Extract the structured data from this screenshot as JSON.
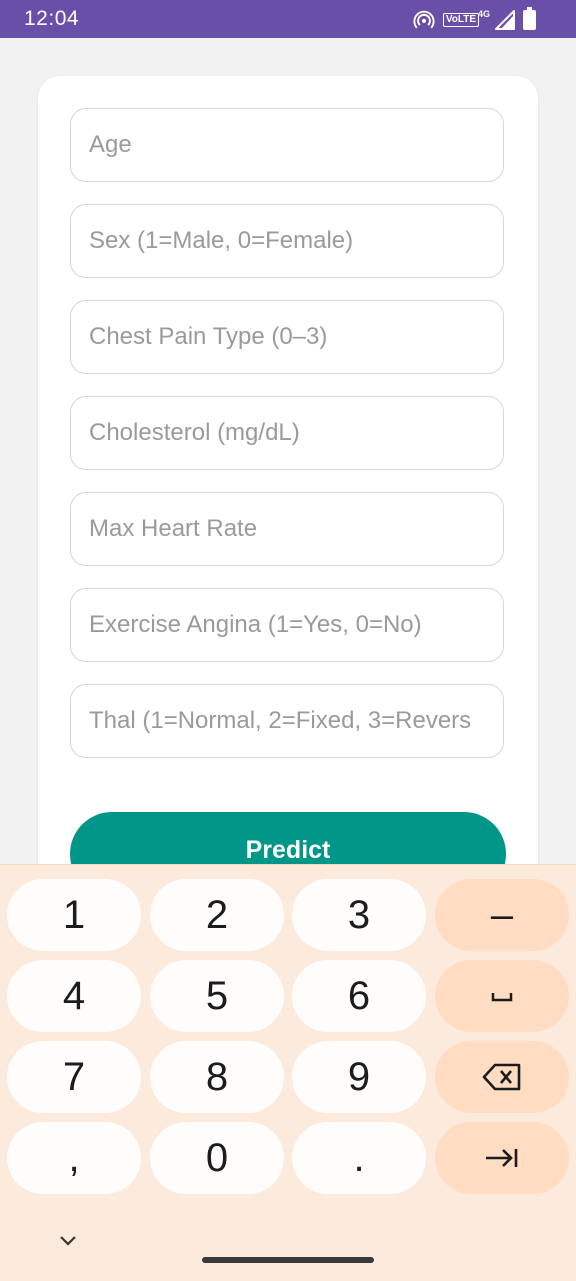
{
  "status_bar": {
    "time": "12:04",
    "volte": "VoLTE",
    "network": "4G",
    "icons": [
      "hotspot-icon",
      "signal-icon",
      "battery-icon"
    ]
  },
  "form": {
    "fields": [
      {
        "name": "age-field",
        "placeholder": "Age",
        "value": ""
      },
      {
        "name": "sex-field",
        "placeholder": "Sex (1=Male, 0=Female)",
        "value": ""
      },
      {
        "name": "chest-pain-type-field",
        "placeholder": "Chest Pain Type (0–3)",
        "value": ""
      },
      {
        "name": "cholesterol-field",
        "placeholder": "Cholesterol (mg/dL)",
        "value": ""
      },
      {
        "name": "max-heart-rate-field",
        "placeholder": "Max Heart Rate",
        "value": ""
      },
      {
        "name": "exercise-angina-field",
        "placeholder": "Exercise Angina (1=Yes, 0=No)",
        "value": ""
      },
      {
        "name": "thal-field",
        "placeholder": "Thal (1=Normal, 2=Fixed, 3=Revers",
        "value": ""
      }
    ],
    "predict_label": "Predict",
    "accent_color": "#009688"
  },
  "keyboard": {
    "rows": [
      [
        "1",
        "2",
        "3",
        "–"
      ],
      [
        "4",
        "5",
        "6",
        "space-icon"
      ],
      [
        "7",
        "8",
        "9",
        "backspace-icon"
      ],
      [
        ",",
        "0",
        ".",
        "tab-icon"
      ]
    ],
    "collapse_icon": "chevron-down-icon",
    "background_color": "#fcebdd",
    "function_key_color": "#ffdcc2"
  }
}
